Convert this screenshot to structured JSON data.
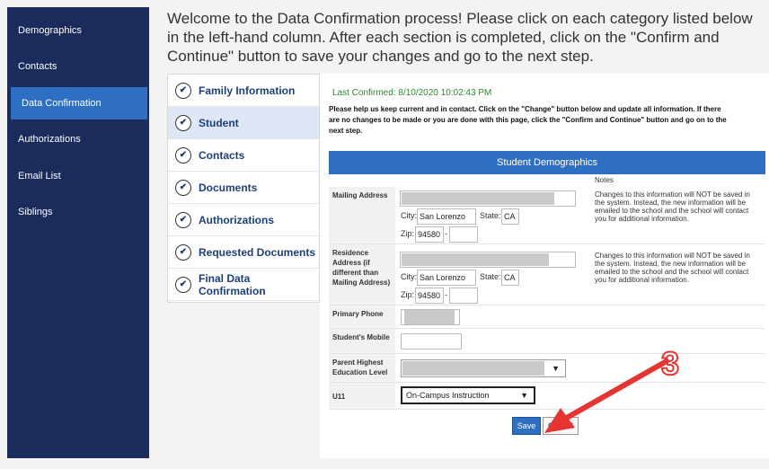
{
  "nav": {
    "items": [
      {
        "label": "Demographics"
      },
      {
        "label": "Contacts"
      },
      {
        "label": "Data Confirmation",
        "active": true
      },
      {
        "label": "Authorizations"
      },
      {
        "label": "Email List"
      },
      {
        "label": "Siblings"
      }
    ]
  },
  "intro": {
    "text": "Welcome to the Data Confirmation process! Please click on each category listed below in the left-hand column. After each section is completed, click on the \"Confirm and Continue\" button to save your changes and go to the next step."
  },
  "steps": [
    {
      "label": "Family Information"
    },
    {
      "label": "Student",
      "active": true
    },
    {
      "label": "Contacts"
    },
    {
      "label": "Documents"
    },
    {
      "label": "Authorizations"
    },
    {
      "label": "Requested Documents"
    },
    {
      "label": "Final Data Confirmation"
    }
  ],
  "main": {
    "last_confirmed": "Last Confirmed: 8/10/2020 10:02:43 PM",
    "help_text": "Please help us keep current and in contact. Click on the \"Change\" button below and update all information. If there are no changes to be made or you are done with this page, click the \"Confirm and Continue\" button and go on to the next step.",
    "table_title": "Student Demographics",
    "notes_header": "Notes",
    "rows": {
      "mailing": {
        "label": "Mailing Address",
        "city_label": "City:",
        "city": "San Lorenzo",
        "state_label": "State:",
        "state": "CA",
        "zip_label": "Zip:",
        "zip": "94580",
        "dash": "-",
        "note": "Changes to this information will NOT be saved in the system. Instead, the new information will be emailed to the school and the school will contact you for additional information."
      },
      "residence": {
        "label": "Residence Address (if different than Mailing Address)",
        "city_label": "City:",
        "city": "San Lorenzo",
        "state_label": "State:",
        "state": "CA",
        "zip_label": "Zip:",
        "zip": "94580",
        "dash": "-",
        "note": "Changes to this information will NOT be saved in the system. Instead, the new information will be emailed to the school and the school will contact you for additional information."
      },
      "primary_phone": {
        "label": "Primary Phone"
      },
      "mobile": {
        "label": "Student's Mobile"
      },
      "parent_edu": {
        "label": "Parent Highest Education Level"
      },
      "u11": {
        "label": "U11",
        "value": "On-Campus Instruction"
      }
    },
    "save_label": "Save",
    "cancel_label": "Cancel"
  },
  "annotation": {
    "number": "3"
  },
  "colors": {
    "nav_bg": "#1a2b5c",
    "accent": "#2f6fc3",
    "arrow": "#e53434"
  }
}
